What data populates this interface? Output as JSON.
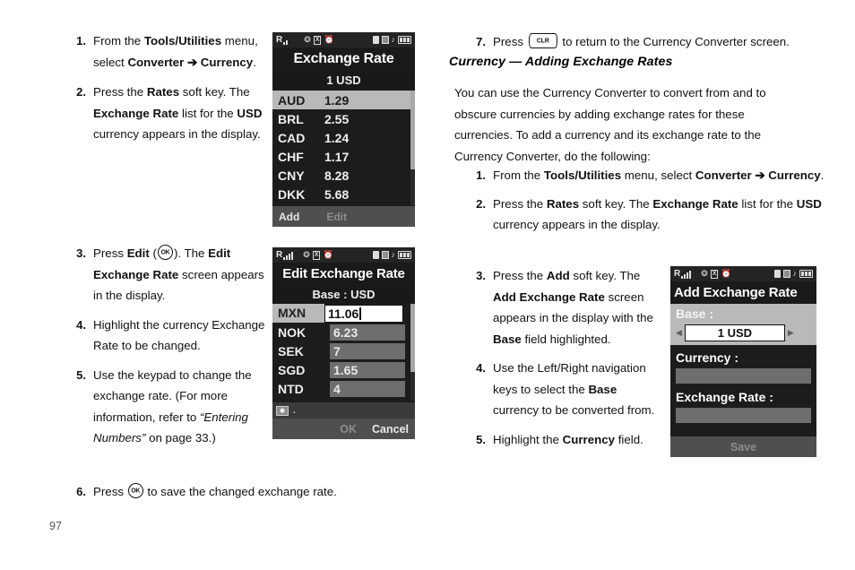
{
  "page": {
    "number": "97"
  },
  "left_column": {
    "steps": [
      {
        "num": "1.",
        "parts": [
          {
            "t": "From the ",
            "s": "n"
          },
          {
            "t": "Tools/Utilities",
            "s": "b"
          },
          {
            "t": " menu, select ",
            "s": "n"
          },
          {
            "t": "Converter ➔",
            "s": "b"
          },
          {
            "t": " ",
            "s": "n"
          },
          {
            "t": "Currency",
            "s": "b"
          },
          {
            "t": ".",
            "s": "n"
          }
        ]
      },
      {
        "num": "2.",
        "parts": [
          {
            "t": "Press the ",
            "s": "n"
          },
          {
            "t": "Rates",
            "s": "b"
          },
          {
            "t": " soft key. The ",
            "s": "n"
          },
          {
            "t": "Exchange Rate",
            "s": "b"
          },
          {
            "t": " list for the ",
            "s": "n"
          },
          {
            "t": "USD",
            "s": "b"
          },
          {
            "t": " currency appears in the display.",
            "s": "n"
          }
        ]
      },
      {
        "num": "3.",
        "parts": [
          {
            "t": "Press ",
            "s": "n"
          },
          {
            "t": "Edit",
            "s": "b"
          },
          {
            "t": " (",
            "s": "n"
          },
          {
            "t": "",
            "s": "ok"
          },
          {
            "t": "). The ",
            "s": "n"
          },
          {
            "t": "Edit Exchange Rate",
            "s": "b"
          },
          {
            "t": " screen appears in the display.",
            "s": "n"
          }
        ]
      },
      {
        "num": "4.",
        "parts": [
          {
            "t": "Highlight the currency Exchange Rate to be changed.",
            "s": "n"
          }
        ]
      },
      {
        "num": "5.",
        "parts": [
          {
            "t": "Use the keypad to change the exchange rate. (For more information, refer to ",
            "s": "n"
          },
          {
            "t": "“Entering Numbers”",
            "s": "i"
          },
          {
            "t": " on page 33.)",
            "s": "n"
          }
        ]
      },
      {
        "num": "6.",
        "parts": [
          {
            "t": "Press ",
            "s": "n"
          },
          {
            "t": "",
            "s": "ok"
          },
          {
            "t": " to save the changed exchange rate.",
            "s": "n"
          }
        ]
      }
    ]
  },
  "right_column": {
    "step7": {
      "num": "7.",
      "parts": [
        {
          "t": "Press ",
          "s": "n"
        },
        {
          "t": "",
          "s": "clr"
        },
        {
          "t": " to return to the Currency Converter screen.",
          "s": "n"
        }
      ]
    },
    "section_heading": "Currency — Adding Exchange Rates",
    "intro": "You can use the Currency Converter to convert from and to obscure currencies by adding exchange rates for these currencies. To add a currency and its exchange rate to the Currency Converter, do the following:",
    "steps": [
      {
        "num": "1.",
        "parts": [
          {
            "t": "From the ",
            "s": "n"
          },
          {
            "t": "Tools/Utilities",
            "s": "b"
          },
          {
            "t": " menu, select ",
            "s": "n"
          },
          {
            "t": "Converter ➔",
            "s": "b"
          },
          {
            "t": " ",
            "s": "n"
          },
          {
            "t": "Currency",
            "s": "b"
          },
          {
            "t": ".",
            "s": "n"
          }
        ]
      },
      {
        "num": "2.",
        "parts": [
          {
            "t": "Press the ",
            "s": "n"
          },
          {
            "t": "Rates",
            "s": "b"
          },
          {
            "t": " soft key. The ",
            "s": "n"
          },
          {
            "t": "Exchange Rate",
            "s": "b"
          },
          {
            "t": " list for the ",
            "s": "n"
          },
          {
            "t": "USD",
            "s": "b"
          },
          {
            "t": " currency appears in the display.",
            "s": "n"
          }
        ]
      },
      {
        "num": "3.",
        "parts": [
          {
            "t": "Press the ",
            "s": "n"
          },
          {
            "t": "Add",
            "s": "b"
          },
          {
            "t": " soft key. The ",
            "s": "n"
          },
          {
            "t": "Add Exchange Rate",
            "s": "b"
          },
          {
            "t": " screen appears in the display with the ",
            "s": "n"
          },
          {
            "t": "Base",
            "s": "b"
          },
          {
            "t": " field highlighted.",
            "s": "n"
          }
        ]
      },
      {
        "num": "4.",
        "parts": [
          {
            "t": "Use the Left/Right navigation keys to select the ",
            "s": "n"
          },
          {
            "t": "Base",
            "s": "b"
          },
          {
            "t": " currency to be converted from.",
            "s": "n"
          }
        ]
      },
      {
        "num": "5.",
        "parts": [
          {
            "t": "Highlight the ",
            "s": "n"
          },
          {
            "t": "Currency",
            "s": "b"
          },
          {
            "t": " field.",
            "s": "n"
          }
        ]
      }
    ]
  },
  "screen_exchange_rate": {
    "status_signal": "R",
    "title": "Exchange Rate",
    "subtitle": "1 USD",
    "rows": [
      {
        "code": "AUD",
        "value": "1.29",
        "selected": true
      },
      {
        "code": "BRL",
        "value": "2.55",
        "selected": false
      },
      {
        "code": "CAD",
        "value": "1.24",
        "selected": false
      },
      {
        "code": "CHF",
        "value": "1.17",
        "selected": false
      },
      {
        "code": "CNY",
        "value": "8.28",
        "selected": false
      },
      {
        "code": "DKK",
        "value": "5.68",
        "selected": false
      }
    ],
    "softkey_left": "Add",
    "softkey_center": "Edit"
  },
  "screen_edit_exchange_rate": {
    "status_signal": "R",
    "title": "Edit Exchange Rate",
    "subtitle": "Base :   USD",
    "rows": [
      {
        "code": "MXN",
        "value": "11.06",
        "selected": true
      },
      {
        "code": "NOK",
        "value": "6.23",
        "selected": false
      },
      {
        "code": "SEK",
        "value": "7",
        "selected": false
      },
      {
        "code": "SGD",
        "value": "1.65",
        "selected": false
      },
      {
        "code": "NTD",
        "value": "4",
        "selected": false
      }
    ],
    "ime_mode": "✱",
    "ime_punct": ".",
    "softkey_ok": "OK",
    "softkey_cancel": "Cancel"
  },
  "screen_add_exchange_rate": {
    "status_signal": "R",
    "title": "Add Exchange Rate",
    "base_label": "Base :",
    "base_value": "1 USD",
    "currency_label": "Currency :",
    "currency_value": "",
    "rate_label": "Exchange Rate :",
    "rate_value": "",
    "softkey_save": "Save"
  },
  "colors": {
    "screen_bg": "#1c1c1c",
    "highlight": "#b9b9b9",
    "softbar": "#4f4f4f",
    "field": "#6e6e6e"
  }
}
